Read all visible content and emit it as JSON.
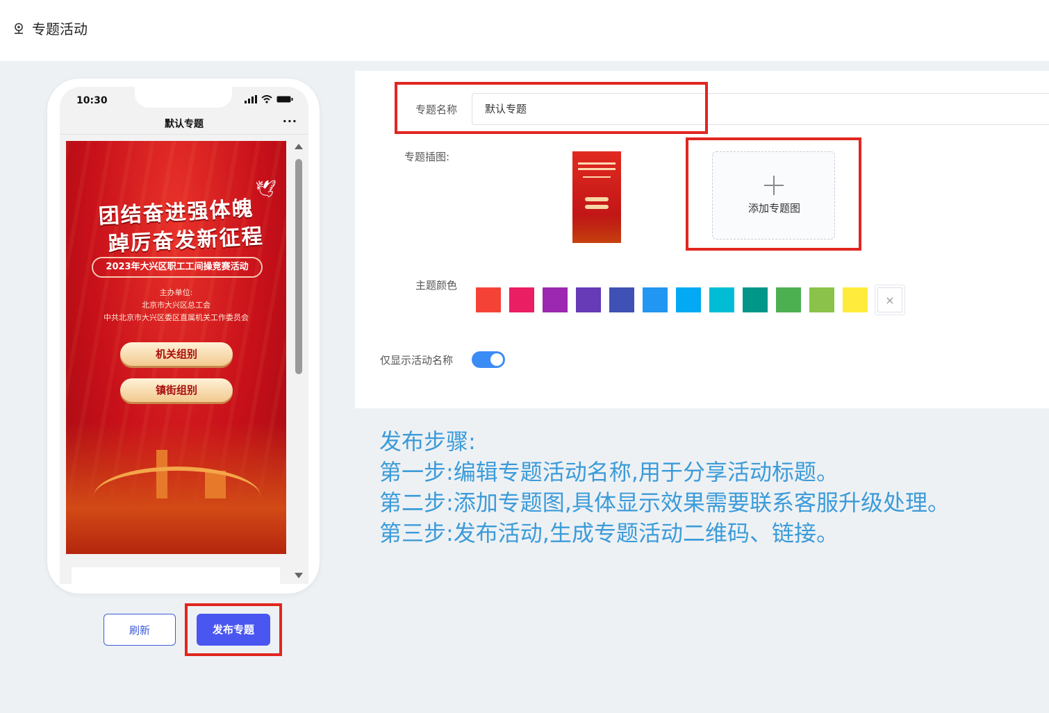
{
  "header": {
    "title": "专题活动",
    "icon": "location-pin-icon"
  },
  "phone": {
    "status_time": "10:30",
    "nav_title": "默认专题",
    "nav_more": "···",
    "poster": {
      "headline_1": "团结奋进强体魄",
      "headline_2": "踔厉奋发新征程",
      "event": "2023年大兴区职工工间操竞赛活动",
      "host_label": "主办单位:",
      "host_1": "北京市大兴区总工会",
      "host_2": "中共北京市大兴区委区直属机关工作委员会",
      "buttons": [
        "机关组别",
        "镇街组别"
      ]
    }
  },
  "actions": {
    "refresh": "刷新",
    "publish": "发布专题"
  },
  "form": {
    "name_label": "专题名称",
    "name_value": "默认专题",
    "image_label": "专题插图:",
    "add_image_label": "添加专题图",
    "color_label": "主题颜色",
    "colors": [
      "#f44336",
      "#e91e63",
      "#9c27b0",
      "#673ab7",
      "#3f51b5",
      "#2196f3",
      "#03a9f4",
      "#00bcd4",
      "#009688",
      "#4caf50",
      "#8bc34a",
      "#ffeb3b"
    ],
    "clear_color": "×",
    "toggle_label": "仅显示活动名称",
    "toggle_on": true
  },
  "instructions": [
    "发布步骤:",
    "第一步:编辑专题活动名称,用于分享活动标题。",
    "第二步:添加专题图,具体显示效果需要联系客服升级处理。",
    "第三步:发布活动,生成专题活动二维码、链接。"
  ]
}
